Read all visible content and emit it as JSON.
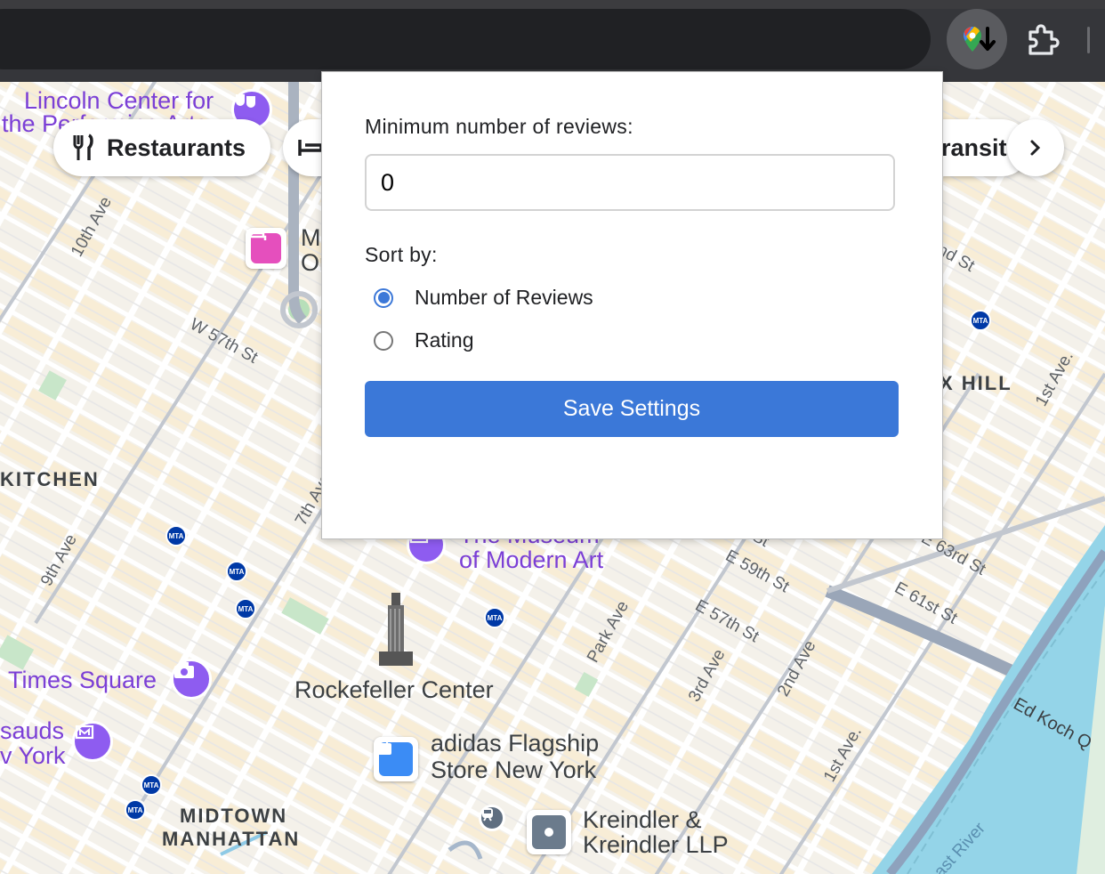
{
  "map": {
    "chips": {
      "restaurants": "Restaurants",
      "transit_partial": "ransit"
    },
    "labels": {
      "lincoln_1": "Lincoln Center for",
      "lincoln_2": "the Performing Arts",
      "hotel_partial_1": "M",
      "hotel_partial_2": "Or",
      "tenth_ave": "10th Ave",
      "w57": "W 57th St",
      "kitchen": "KITCHEN",
      "ninth_ave": "9th Ave",
      "seventh_ave": "7th Ave",
      "moma_1": "The Museum",
      "moma_2": "of Modern Art",
      "times_square": "Times Square",
      "rockefeller": "Rockefeller Center",
      "adidas_1": "adidas Flagship",
      "adidas_2": "Store New York",
      "kreindler_1": "Kreindler &",
      "kreindler_2": "Kreindler LLP",
      "midtown_1": "MIDTOWN",
      "midtown_2": "MANHATTAN",
      "madame_1": "sauds",
      "madame_2": "v York",
      "park_ave": "Park Ave",
      "third_ave": "3rd Ave",
      "second_ave": "2nd Ave",
      "first_ave_low": "1st Ave.",
      "e59": "E 59th St",
      "e57": "E 57th St",
      "e61": "E 61st St",
      "e63": "E 63rd St",
      "e_st_partial": "St",
      "hill": "X HILL",
      "first_ave_high": "1st Ave.",
      "nd_st": "nd St",
      "ed_koch": "Ed Koch Q",
      "east_river": "ast River",
      "mta": "MTA"
    }
  },
  "popup": {
    "min_reviews_label": "Minimum number of reviews:",
    "min_reviews_value": "0",
    "sort_by_label": "Sort by:",
    "options": [
      {
        "label": "Number of Reviews",
        "selected": true
      },
      {
        "label": "Rating",
        "selected": false
      }
    ],
    "save_label": "Save Settings"
  },
  "colors": {
    "accent": "#3b78d8",
    "toolbar": "#35363a",
    "water": "#94d4e8",
    "poi_purple": "#7b3fd6"
  }
}
